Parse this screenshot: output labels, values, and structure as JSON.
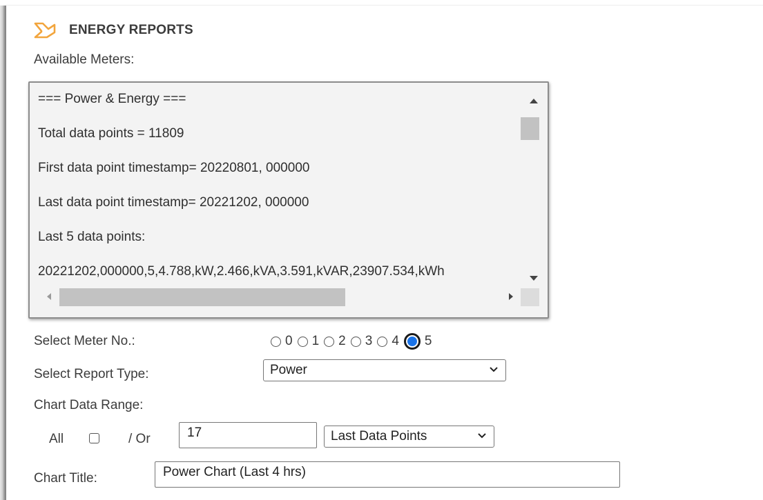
{
  "header": {
    "title": "ENERGY REPORTS",
    "icon": "arrow-icon",
    "icon_color": "#f2a53d"
  },
  "meters": {
    "label": "Available Meters:",
    "lines": [
      "=== Power & Energy ===",
      "Total data points = 11809",
      "First data point timestamp= 20220801, 000000",
      "Last data point timestamp= 20221202, 000000",
      "Last 5 data points:",
      "20221202,000000,5,4.788,kW,2.466,kVA,3.591,kVAR,23907.534,kWh"
    ]
  },
  "meter_select": {
    "label": "Select Meter No.:",
    "options": [
      "0",
      "1",
      "2",
      "3",
      "4",
      "5"
    ],
    "selected": "5",
    "accent": "#1a73e8"
  },
  "report_type": {
    "label": "Select Report Type:",
    "value": "Power"
  },
  "range": {
    "label": "Chart Data Range:",
    "all_label": "All",
    "all_checked": false,
    "or_label": "/ Or",
    "count_value": "17",
    "mode_value": "Last Data Points"
  },
  "chart_title": {
    "label": "Chart Title:",
    "value": "Power Chart (Last 4 hrs)"
  }
}
